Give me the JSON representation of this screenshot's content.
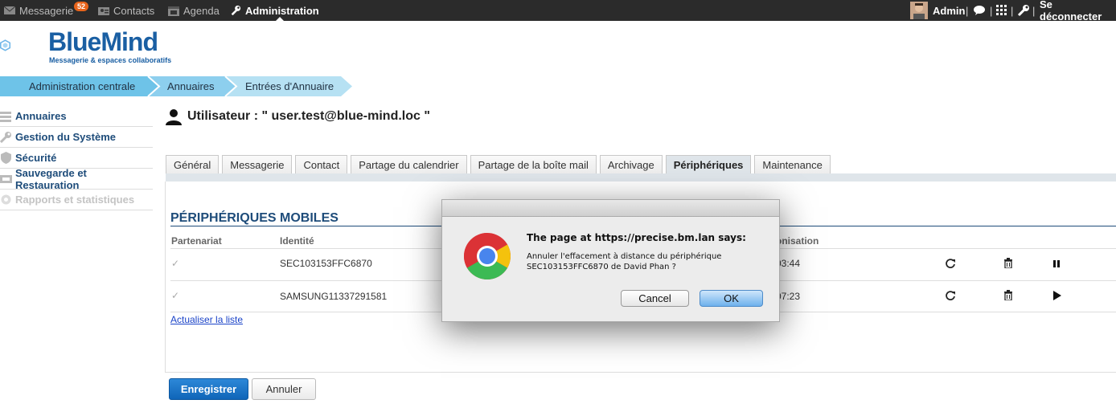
{
  "topbar": {
    "apps": [
      {
        "label": "Messagerie",
        "icon": "mail-icon",
        "badge": "52"
      },
      {
        "label": "Contacts",
        "icon": "contacts-icon"
      },
      {
        "label": "Agenda",
        "icon": "calendar-icon"
      },
      {
        "label": "Administration",
        "icon": "wrench-icon",
        "active": true
      }
    ],
    "user": "Admin",
    "logout": "Se déconnecter"
  },
  "brand": {
    "name": "BlueMind",
    "tagline": "Messagerie & espaces collaboratifs",
    "color": "#1a5fa3"
  },
  "breadcrumb": [
    "Administration centrale",
    "Annuaires",
    "Entrées d'Annuaire"
  ],
  "sidebar": {
    "items": [
      {
        "label": "Annuaires",
        "icon": "list-icon"
      },
      {
        "label": "Gestion du Système",
        "icon": "wrench-icon"
      },
      {
        "label": "Sécurité",
        "icon": "shield-icon"
      },
      {
        "label": "Sauvegarde et Restauration",
        "icon": "backup-icon"
      },
      {
        "label": "Rapports et statistiques",
        "icon": "gear-icon",
        "disabled": true
      }
    ]
  },
  "page": {
    "title": "Utilisateur : \" user.test@blue-mind.loc \""
  },
  "tabs": [
    "Général",
    "Messagerie",
    "Contact",
    "Partage du calendrier",
    "Partage de la boîte mail",
    "Archivage",
    "Périphériques",
    "Maintenance"
  ],
  "active_tab": "Périphériques",
  "devices": {
    "title": "PÉRIPHÉRIQUES MOBILES",
    "columns": [
      "Partenariat",
      "Identité",
      "onisation"
    ],
    "rows": [
      {
        "identity": "SEC103153FFC6870",
        "sync": "03:44",
        "action": "pause"
      },
      {
        "identity": "SAMSUNG11337291581",
        "sync": "07:23",
        "action": "play"
      }
    ],
    "refresh_link": "Actualiser la liste"
  },
  "buttons": {
    "save": "Enregistrer",
    "cancel": "Annuler"
  },
  "dialog": {
    "title": "The page at https://precise.bm.lan says:",
    "message": "Annuler l'effacement à distance du périphérique SEC103153FFC6870 de David Phan ?",
    "cancel": "Cancel",
    "ok": "OK"
  }
}
